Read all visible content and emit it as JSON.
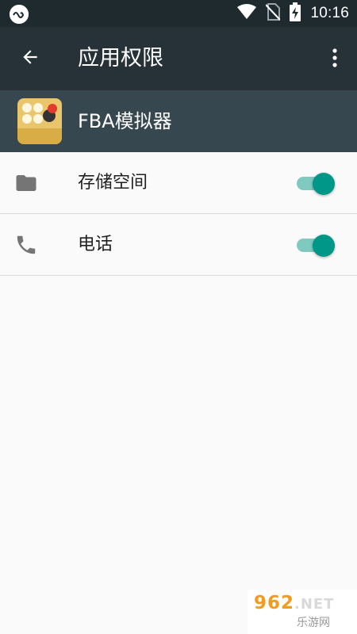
{
  "status_bar": {
    "time": "10:16",
    "icons": [
      "app-notification-icon",
      "wifi-icon",
      "no-sim-icon",
      "battery-charging-icon"
    ]
  },
  "app_bar": {
    "title": "应用权限",
    "back_icon": "arrow-back-icon",
    "menu_icon": "more-vert-icon"
  },
  "app_info": {
    "name": "FBA模拟器",
    "icon_text": "FBA模拟器"
  },
  "permissions": [
    {
      "label": "存储空间",
      "icon": "folder-icon",
      "enabled": true
    },
    {
      "label": "电话",
      "icon": "phone-icon",
      "enabled": true
    }
  ],
  "watermark": {
    "brand": "962",
    "tld": ".NET",
    "tagline": "乐游网"
  },
  "colors": {
    "status_bar": "#1f2a2f",
    "app_bar": "#263238",
    "app_info_bar": "#37474f",
    "switch_thumb": "#009688",
    "switch_track": "#7fc9c1"
  }
}
